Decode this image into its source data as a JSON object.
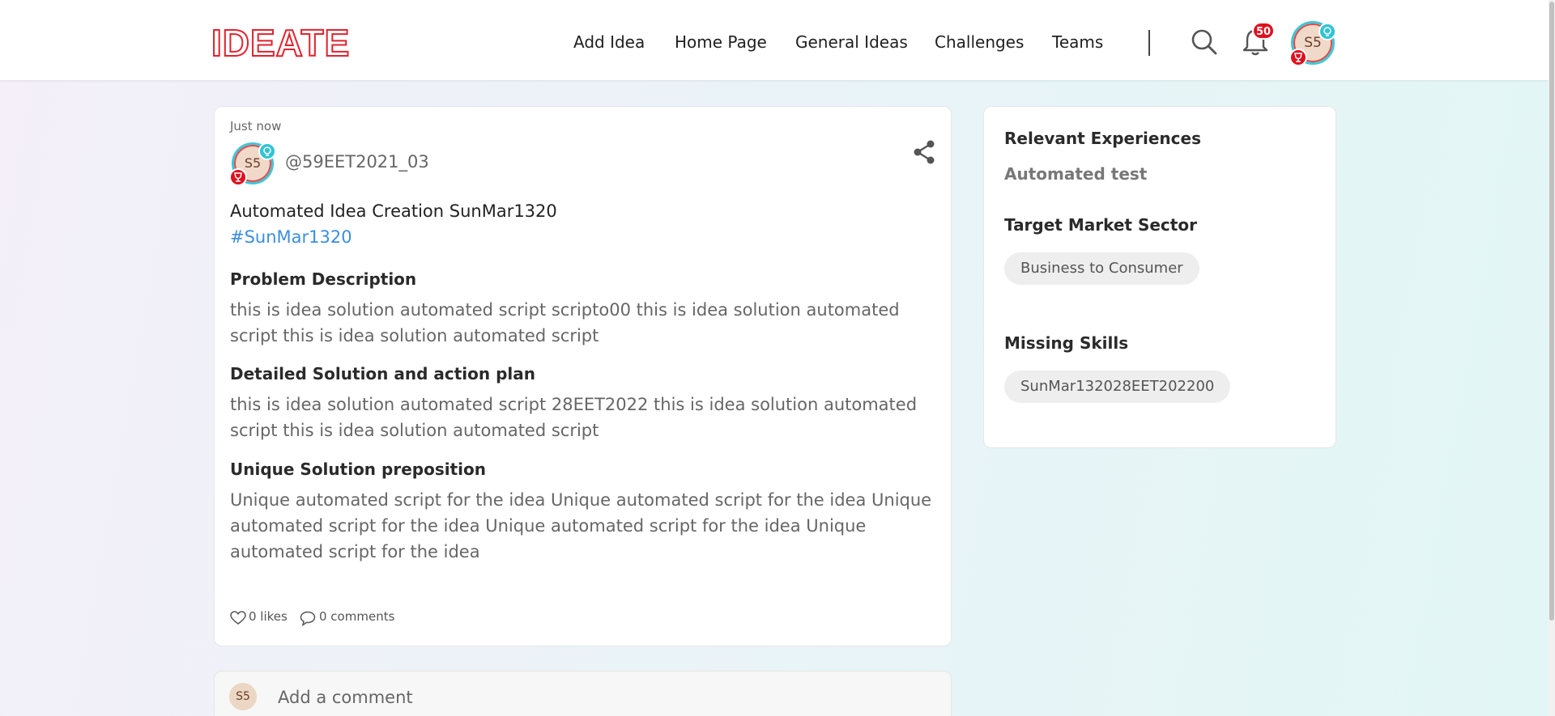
{
  "brand": {
    "logo_text": "IDEATE",
    "accent_color": "#e0232f"
  },
  "nav": {
    "items": [
      {
        "label": "Add Idea"
      },
      {
        "label": "Home Page"
      },
      {
        "label": "General Ideas"
      },
      {
        "label": "Challenges"
      },
      {
        "label": "Teams"
      }
    ],
    "notification_count": "50",
    "user_initials": "S5"
  },
  "post": {
    "timestamp": "Just now",
    "author_initials": "S5",
    "author_handle": "@59EET2021_03",
    "title": "Automated Idea Creation SunMar1320",
    "hashtag": "#SunMar1320",
    "sections": [
      {
        "heading": "Problem Description",
        "body": "this is idea solution automated script scripto00 this is idea solution automated script this is idea solution automated script"
      },
      {
        "heading": "Detailed Solution and action plan",
        "body": "this is idea solution automated script 28EET2022 this is idea solution automated script this is idea solution automated script"
      },
      {
        "heading": "Unique Solution preposition",
        "body": "Unique automated script for the idea Unique automated script for the idea Unique automated script for the idea Unique automated script for the idea Unique automated script for the idea"
      }
    ],
    "likes_text": "0 likes",
    "comments_text": "0 comments"
  },
  "sidebar": {
    "relevant_experiences_label": "Relevant Experiences",
    "relevant_experiences_value": "Automated test",
    "target_market_label": "Target Market Sector",
    "target_market_chip": "Business to Consumer",
    "missing_skills_label": "Missing Skills",
    "missing_skills_chip": "SunMar132028EET202200"
  },
  "comment": {
    "user_initials": "S5",
    "placeholder": "Add a comment"
  }
}
